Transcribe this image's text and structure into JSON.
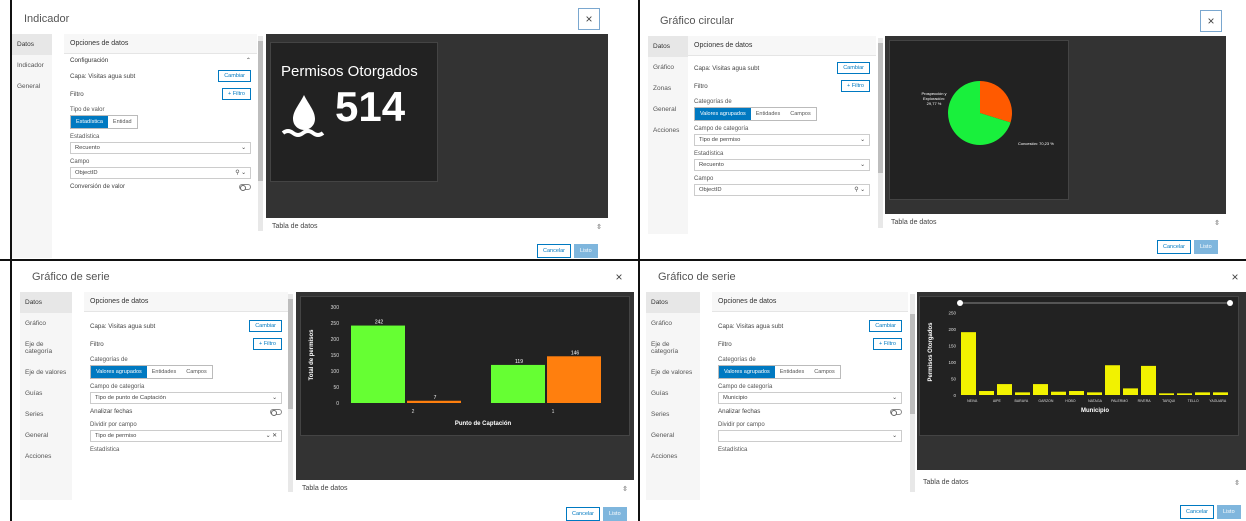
{
  "p1": {
    "title": "Indicador",
    "close": "×",
    "nav": [
      "Datos",
      "Indicador",
      "General"
    ],
    "form_head": "Opciones de datos",
    "config": "Configuración",
    "capa": "Capa: Visitas agua subt",
    "cambiar": "Cambiar",
    "filtro": "Filtro",
    "add_filtro": "+ Filtro",
    "tipo_valor": "Tipo de valor",
    "seg": [
      "Estadística",
      "Entidad"
    ],
    "estadistica": "Estadística",
    "recuento": "Recuento",
    "campo": "Campo",
    "objectid": "ObjectID",
    "conversion": "Conversión de valor",
    "indicator_title": "Permisos Otorgados",
    "indicator_value": "514",
    "tabla": "Tabla de datos",
    "cancelar": "Cancelar",
    "listo": "Listo"
  },
  "p2": {
    "title": "Gráfico circular",
    "close": "×",
    "nav": [
      "Datos",
      "Gráfico",
      "Zonas",
      "General",
      "Acciones"
    ],
    "form_head": "Opciones de datos",
    "capa": "Capa: Visitas agua subt",
    "cambiar": "Cambiar",
    "filtro": "Filtro",
    "add_filtro": "+ Filtro",
    "categorias": "Categorías de",
    "seg": [
      "Valores agrupados",
      "Entidades",
      "Campos"
    ],
    "campo_categoria": "Campo de categoría",
    "tipo_permiso": "Tipo de permiso",
    "estadistica": "Estadística",
    "recuento": "Recuento",
    "campo": "Campo",
    "objectid": "ObjectID",
    "tabla": "Tabla de datos",
    "cancelar": "Cancelar",
    "listo": "Listo"
  },
  "p3": {
    "title": "Gráfico de serie",
    "close": "×",
    "nav": [
      "Datos",
      "Gráfico",
      "Eje de categoría",
      "Eje de valores",
      "Guías",
      "Series",
      "General",
      "Acciones"
    ],
    "form_head": "Opciones de datos",
    "capa": "Capa: Visitas agua subt",
    "cambiar": "Cambiar",
    "filtro": "Filtro",
    "add_filtro": "+ Filtro",
    "categorias": "Categorías de",
    "seg": [
      "Valores agrupados",
      "Entidades",
      "Campos"
    ],
    "campo_categoria": "Campo de categoría",
    "tipo_punto": "Tipo de punto de Captación",
    "analizar": "Analizar fechas",
    "dividir": "Dividir por campo",
    "tipo_permiso": "Tipo de permiso",
    "estadistica": "Estadística",
    "tabla": "Tabla de datos",
    "cancelar": "Cancelar",
    "listo": "Listo"
  },
  "p4": {
    "title": "Gráfico de serie",
    "close": "×",
    "nav": [
      "Datos",
      "Gráfico",
      "Eje de categoría",
      "Eje de valores",
      "Guías",
      "Series",
      "General",
      "Acciones"
    ],
    "form_head": "Opciones de datos",
    "capa": "Capa: Visitas agua subt",
    "cambiar": "Cambiar",
    "filtro": "Filtro",
    "add_filtro": "+ Filtro",
    "categorias": "Categorías de",
    "seg": [
      "Valores agrupados",
      "Entidades",
      "Campos"
    ],
    "campo_categoria": "Campo de categoría",
    "municipio": "Municipio",
    "analizar": "Analizar fechas",
    "dividir": "Dividir por campo",
    "estadistica": "Estadística",
    "tabla": "Tabla de datos",
    "cancelar": "Cancelar",
    "listo": "Listo"
  },
  "chart_data": [
    {
      "type": "pie",
      "categories": [
        "Prospección y Exploración",
        "Concesión"
      ],
      "values": [
        29.77,
        70.23
      ],
      "labels": [
        "Prospección y\nExploración:\n29,77 %",
        "Concesión: 70,23 %"
      ],
      "colors": [
        "#ff5a00",
        "#19f03c"
      ]
    },
    {
      "type": "bar",
      "categories": [
        "2",
        "1"
      ],
      "series": [
        {
          "values": [
            242,
            146
          ],
          "color_pairs": true
        }
      ],
      "bars": [
        {
          "category": "2",
          "value": 242,
          "color": "#66ff33"
        },
        {
          "category": "2",
          "value": 7,
          "color": "#ff7f0e"
        },
        {
          "category": "1",
          "value": 119,
          "color": "#66ff33"
        },
        {
          "category": "1",
          "value": 146,
          "color": "#ff7f0e"
        }
      ],
      "ylabel": "Total de permisos",
      "xlabel": "Punto de Captación",
      "yticks": [
        "0",
        "50",
        "100",
        "150",
        "200",
        "250",
        "300"
      ],
      "ylim": [
        0,
        300
      ]
    },
    {
      "type": "bar",
      "categories": [
        "NEIVA",
        "AIPE",
        "BARAYA",
        "GARZON",
        "HOBO",
        "NATAGA",
        "PALERMO",
        "RIVERA",
        "TARQUI",
        "TELLO",
        "YAGUARA"
      ],
      "values": [
        190,
        12,
        33,
        8,
        33,
        10,
        12,
        8,
        90,
        88,
        5,
        5,
        8,
        8
      ],
      "bar_values": [
        190,
        12,
        33,
        8,
        33,
        10,
        12,
        8,
        90,
        20,
        88,
        5,
        5,
        8,
        8
      ],
      "ylabel": "Permisos Otorgados",
      "xlabel": "Municipio",
      "yticks": [
        "0",
        "50",
        "100",
        "150",
        "200",
        "250"
      ],
      "ylim": [
        0,
        260
      ],
      "color": "#f2f200"
    }
  ]
}
